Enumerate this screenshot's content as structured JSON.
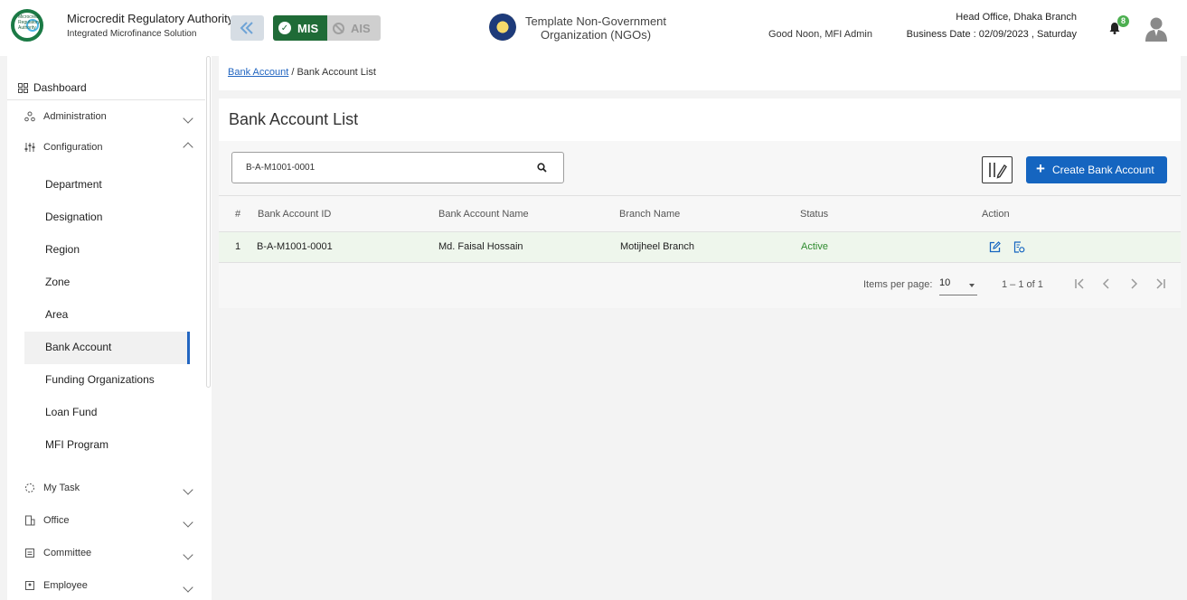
{
  "header": {
    "org_title": "Microcredit Regulatory Authority",
    "org_subtitle": "Integrated Microfinance Solution",
    "logo_text": "Microcredit Regulatory Authority",
    "mis_label": "MIS",
    "ais_label": "AIS",
    "ngo_line1": "Template Non-Government",
    "ngo_line2": "Organization (NGOs)",
    "greeting": "Good Noon, MFI Admin",
    "branch": "Head Office, Dhaka Branch",
    "business_date": "Business Date : 02/09/2023 , Saturday",
    "notification_count": "8",
    "icons": {
      "collapse": "double-chevron-left-icon",
      "bell": "bell-icon",
      "avatar": "user-avatar-icon"
    },
    "colors": {
      "mis": "#1f6b37",
      "accent": "#1565c0"
    }
  },
  "sidebar": {
    "dashboard": "Dashboard",
    "groups": [
      {
        "label": "Administration",
        "icon": "admin-icon",
        "expanded": false
      },
      {
        "label": "Configuration",
        "icon": "sliders-icon",
        "expanded": true
      }
    ],
    "config_items": [
      "Department",
      "Designation",
      "Region",
      "Zone",
      "Area",
      "Bank Account",
      "Funding Organizations",
      "Loan Fund",
      "MFI Program"
    ],
    "active_item": "Bank Account",
    "bottom_groups": [
      {
        "label": "My Task",
        "icon": "task-icon"
      },
      {
        "label": "Office",
        "icon": "office-icon"
      },
      {
        "label": "Committee",
        "icon": "committee-icon"
      },
      {
        "label": "Employee",
        "icon": "employee-icon"
      }
    ]
  },
  "breadcrumb": {
    "link": "Bank Account",
    "separator": "/",
    "current": "Bank Account List"
  },
  "page": {
    "title": "Bank Account List",
    "search_value": "B-A-M1001-0001",
    "create_label": "Create Bank Account"
  },
  "table": {
    "columns": [
      "#",
      "Bank Account ID",
      "Bank Account Name",
      "Branch Name",
      "Status",
      "Action"
    ],
    "rows": [
      {
        "index": "1",
        "id": "B-A-M1001-0001",
        "name": "Md. Faisal Hossain",
        "branch": "Motijheel Branch",
        "status": "Active"
      }
    ]
  },
  "pagination": {
    "items_per_page_label": "Items per page:",
    "items_per_page": "10",
    "range": "1 – 1 of 1"
  }
}
